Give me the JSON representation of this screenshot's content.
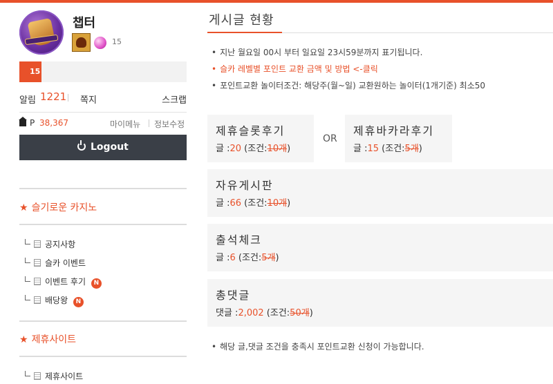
{
  "colors": {
    "accent": "#e8512a",
    "button_dark": "#3a3f47",
    "card_bg": "#f5f5f5"
  },
  "profile": {
    "nickname": "챕터",
    "level_icon": "level-emblem-icon",
    "gem_icon": "pink-gem-icon",
    "gem_count": "15",
    "level_bar_value": "15",
    "alarm_label": "알림",
    "alarm_count": "1221",
    "memo_label": "쪽지",
    "scrap_label": "스크랩",
    "point_icon": "home-icon",
    "point_label": "P",
    "point_value": "38,367",
    "mymenu_label": "마이메뉴",
    "edit_info_label": "정보수정",
    "logout_label": "Logout"
  },
  "sidebar": {
    "sections": [
      {
        "title": "슬기로운 카지노",
        "items": [
          {
            "label": "공지사항",
            "badge": ""
          },
          {
            "label": "슬카 이벤트",
            "badge": ""
          },
          {
            "label": "이벤트 후기",
            "badge": "N"
          },
          {
            "label": "배당왕",
            "badge": "N"
          }
        ]
      },
      {
        "title": "제휴사이트",
        "items": [
          {
            "label": "제휴사이트",
            "badge": ""
          }
        ]
      }
    ]
  },
  "main": {
    "title": "게시글 현황",
    "notes": [
      "지난 월요일 00시 부터 일요일 23시59분까지 표기됩니다.",
      "슬카 레벨별 포인트 교환 금액 및 방법 <-클릭",
      "포인트교환 놀이터조건: 해당주(월~일) 교환원하는 놀이터(1개기준) 최소50"
    ],
    "or_label": "OR",
    "cards": [
      {
        "title": "제휴슬롯후기",
        "prefix": "글 :",
        "value": "20",
        "cond_label": "(조건:",
        "cond_value": "10개",
        "close": ")"
      },
      {
        "title": "제휴바카라후기",
        "prefix": "글 :",
        "value": "15",
        "cond_label": "(조건:",
        "cond_value": "5개",
        "close": ")"
      },
      {
        "title": "자유게시판",
        "prefix": "글 :",
        "value": "66",
        "cond_label": "(조건:",
        "cond_value": "10개",
        "close": ")"
      },
      {
        "title": "출석체크",
        "prefix": "글 :",
        "value": "6",
        "cond_label": "(조건:",
        "cond_value": "5개",
        "close": ")"
      },
      {
        "title": "총댓글",
        "prefix": "댓글 :",
        "value": "2,002",
        "cond_label": "(조건:",
        "cond_value": "50개",
        "close": ")"
      }
    ],
    "footer_note": "해당 글,댓글 조건을 충족시 포인트교환 신청이 가능합니다."
  }
}
